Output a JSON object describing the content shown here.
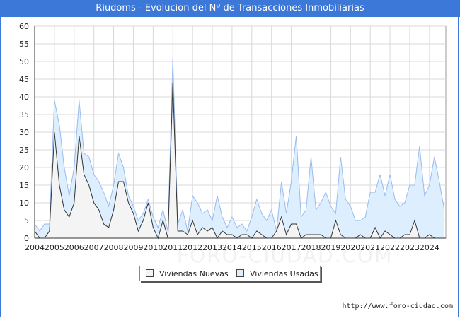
{
  "title": "Riudoms - Evolucion del Nº de Transacciones Inmobiliarias",
  "watermark": "FORO-CIUDAD.COM",
  "footer": "http://www.foro-ciudad.com",
  "legend": {
    "nuevas": "Viviendas Nuevas",
    "usadas": "Viviendas Usadas"
  },
  "colors": {
    "nuevas_fill": "#f4f4f4",
    "nuevas_line": "#333333",
    "usadas_fill": "#ddeeff",
    "usadas_line": "#99bbee",
    "title_bg": "#3c78d8"
  },
  "chart_data": {
    "type": "area",
    "xlabel": "",
    "ylabel": "",
    "ylim": [
      0,
      60
    ],
    "yticks": [
      0,
      5,
      10,
      15,
      20,
      25,
      30,
      35,
      40,
      45,
      50,
      55,
      60
    ],
    "xlim": [
      2004,
      2024.83
    ],
    "xticks": [
      "2004",
      "2005",
      "2006",
      "2007",
      "2008",
      "2009",
      "2010",
      "2011",
      "2012",
      "2013",
      "2014",
      "2015",
      "2016",
      "2017",
      "2018",
      "2019",
      "2020",
      "2021",
      "2022",
      "2023",
      "2024"
    ],
    "grid": true,
    "legend_position": "bottom-center",
    "x_start": 2004,
    "x_step": 0.25,
    "series": [
      {
        "name": "Viviendas Nuevas",
        "values": [
          2,
          0,
          0,
          2,
          30,
          15,
          8,
          6,
          10,
          29,
          18,
          15,
          10,
          8,
          4,
          3,
          8,
          16,
          16,
          10,
          7,
          2,
          5,
          10,
          3,
          0,
          5,
          0,
          44,
          2,
          2,
          1,
          5,
          1,
          3,
          2,
          3,
          0,
          2,
          1,
          1,
          0,
          1,
          1,
          0,
          2,
          1,
          0,
          0,
          2,
          6,
          1,
          4,
          4,
          0,
          1,
          1,
          1,
          1,
          0,
          0,
          5,
          1,
          0,
          0,
          0,
          1,
          0,
          0,
          3,
          0,
          2,
          1,
          0,
          0,
          1,
          1,
          5,
          0,
          0,
          1,
          0,
          0
        ]
      },
      {
        "name": "Viviendas Usadas",
        "values": [
          4,
          2,
          4,
          4,
          39,
          32,
          20,
          12,
          20,
          39,
          24,
          23,
          18,
          16,
          13,
          9,
          15,
          24,
          20,
          12,
          9,
          5,
          7,
          11,
          6,
          3,
          8,
          2,
          51,
          4,
          8,
          2,
          12,
          10,
          7,
          8,
          5,
          12,
          6,
          3,
          6,
          3,
          4,
          2,
          6,
          11,
          7,
          5,
          8,
          2,
          16,
          7,
          16,
          29,
          6,
          8,
          23,
          8,
          10,
          13,
          9,
          7,
          23,
          11,
          9,
          5,
          5,
          6,
          13,
          13,
          18,
          12,
          18,
          11,
          9,
          10,
          15,
          15,
          26,
          12,
          15,
          23,
          16,
          8
        ]
      }
    ]
  }
}
